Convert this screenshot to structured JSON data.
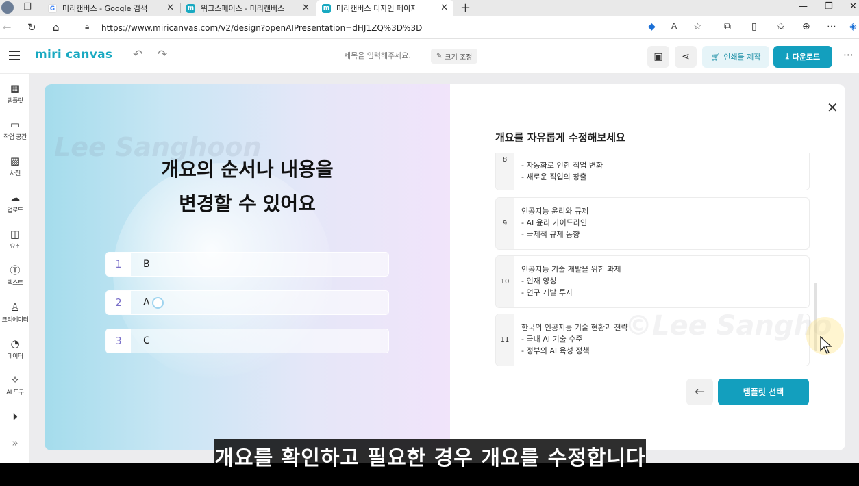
{
  "browser": {
    "tabs": [
      {
        "label": "미리캔버스 - Google 검색",
        "favicon": "google-icon",
        "active": false
      },
      {
        "label": "워크스페이스 - 미리캔버스",
        "favicon": "miricanvas-icon",
        "active": false
      },
      {
        "label": "미리캔버스 디자인 페이지",
        "favicon": "miricanvas-icon",
        "active": true
      }
    ],
    "url": "https://www.miricanvas.com/v2/design?openAIPresentation=dHJ1ZQ%3D%3D"
  },
  "header": {
    "logo": "miri canvas",
    "title_placeholder": "제목을 입력해주세요.",
    "resize_label": "크기 조정",
    "print_label": "인쇄물 제작",
    "download_label": "다운로드"
  },
  "sidebar": {
    "items": [
      {
        "label": "템플릿",
        "icon": "template-icon"
      },
      {
        "label": "작업 공간",
        "icon": "workspace-icon"
      },
      {
        "label": "사진",
        "icon": "photo-icon"
      },
      {
        "label": "업로드",
        "icon": "upload-icon"
      },
      {
        "label": "요소",
        "icon": "elements-icon"
      },
      {
        "label": "텍스트",
        "icon": "text-icon"
      },
      {
        "label": "크리에이터",
        "icon": "creator-icon"
      },
      {
        "label": "데이터",
        "icon": "data-icon"
      },
      {
        "label": "AI 도구",
        "icon": "ai-tools-icon"
      }
    ]
  },
  "slide": {
    "title_line1": "개요의 순서나 내용을",
    "title_line2": "변경할 수 있어요",
    "watermark": "Lee Sanghoon",
    "rows": [
      {
        "num": "1",
        "value": "B"
      },
      {
        "num": "2",
        "value": "A"
      },
      {
        "num": "3",
        "value": "C"
      }
    ]
  },
  "panel": {
    "title": "개요를 자유롭게 수정해보세요",
    "watermark": "©Lee Sangho",
    "items": [
      {
        "num": "8",
        "text": "- 자동화로 인한 직업 변화\n- 새로운 직업의 창출"
      },
      {
        "num": "9",
        "text": "인공지능 윤리와 규제\n- AI 윤리 가이드라인\n- 국제적 규제 동향"
      },
      {
        "num": "10",
        "text": "인공지능 기술 개발을 위한 과제\n- 인재 양성\n- 연구 개발 투자"
      },
      {
        "num": "11",
        "text": "한국의 인공지능 기술 현황과 전략\n- 국내 AI 기술 수준\n- 정부의 AI 육성 정책"
      }
    ],
    "select_template_label": "템플릿 선택"
  },
  "caption": "개요를 확인하고 필요한 경우 개요를 수정합니다",
  "colors": {
    "brand": "#139fbe",
    "logo": "#19a9c1",
    "number_accent": "#7b70c9"
  }
}
